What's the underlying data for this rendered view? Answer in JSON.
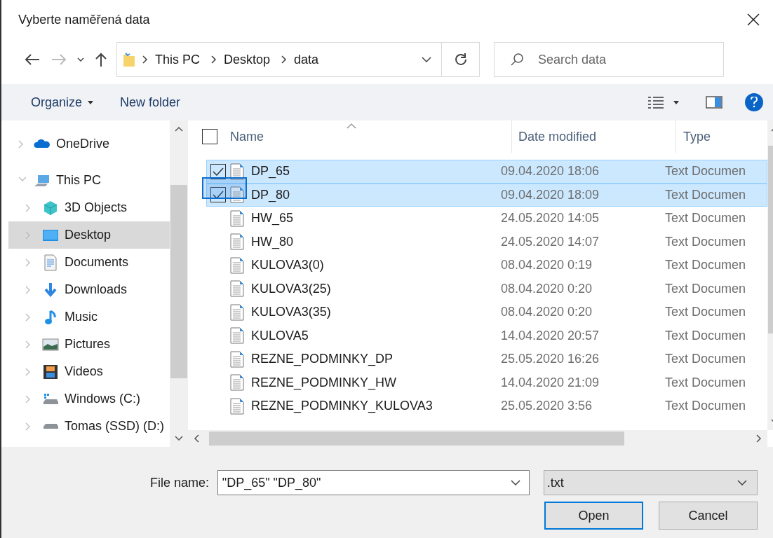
{
  "window": {
    "title": "Vyberte naměřená data"
  },
  "address_bar": {
    "path": [
      "This PC",
      "Desktop",
      "data"
    ]
  },
  "search": {
    "placeholder": "Search data"
  },
  "toolbar": {
    "organize": "Organize",
    "new_folder": "New folder"
  },
  "sidebar": {
    "items": [
      {
        "label": "OneDrive",
        "expanded": false,
        "selected": false
      },
      {
        "label": "This PC",
        "expanded": true,
        "selected": false,
        "children": [
          {
            "label": "3D Objects",
            "selected": false
          },
          {
            "label": "Desktop",
            "selected": true
          },
          {
            "label": "Documents",
            "selected": false
          },
          {
            "label": "Downloads",
            "selected": false
          },
          {
            "label": "Music",
            "selected": false
          },
          {
            "label": "Pictures",
            "selected": false
          },
          {
            "label": "Videos",
            "selected": false
          },
          {
            "label": "Windows (C:)",
            "selected": false
          },
          {
            "label": "Tomas (SSD) (D:)",
            "selected": false
          }
        ]
      }
    ]
  },
  "table": {
    "columns": [
      "Name",
      "Date modified",
      "Type"
    ],
    "select_all_checked": false,
    "rows": [
      {
        "name": "DP_65",
        "date": "09.04.2020 18:06",
        "type": "Text Documen",
        "selected": true
      },
      {
        "name": "DP_80",
        "date": "09.04.2020 18:09",
        "type": "Text Documen",
        "selected": true
      },
      {
        "name": "HW_65",
        "date": "24.05.2020 14:05",
        "type": "Text Documen",
        "selected": false
      },
      {
        "name": "HW_80",
        "date": "24.05.2020 14:07",
        "type": "Text Documen",
        "selected": false
      },
      {
        "name": "KULOVA3(0)",
        "date": "08.04.2020 0:19",
        "type": "Text Documen",
        "selected": false
      },
      {
        "name": "KULOVA3(25)",
        "date": "08.04.2020 0:20",
        "type": "Text Documen",
        "selected": false
      },
      {
        "name": "KULOVA3(35)",
        "date": "08.04.2020 0:20",
        "type": "Text Documen",
        "selected": false
      },
      {
        "name": "KULOVA5",
        "date": "14.04.2020 20:57",
        "type": "Text Documen",
        "selected": false
      },
      {
        "name": "REZNE_PODMINKY_DP",
        "date": "25.05.2020 16:26",
        "type": "Text Documen",
        "selected": false
      },
      {
        "name": "REZNE_PODMINKY_HW",
        "date": "14.04.2020 21:09",
        "type": "Text Documen",
        "selected": false
      },
      {
        "name": "REZNE_PODMINKY_KULOVA3",
        "date": "25.05.2020 3:56",
        "type": "Text Documen",
        "selected": false
      }
    ]
  },
  "file_name": {
    "label": "File name:",
    "value": "\"DP_65\" \"DP_80\""
  },
  "file_type": {
    "value": ".txt"
  },
  "buttons": {
    "open": "Open",
    "cancel": "Cancel"
  }
}
